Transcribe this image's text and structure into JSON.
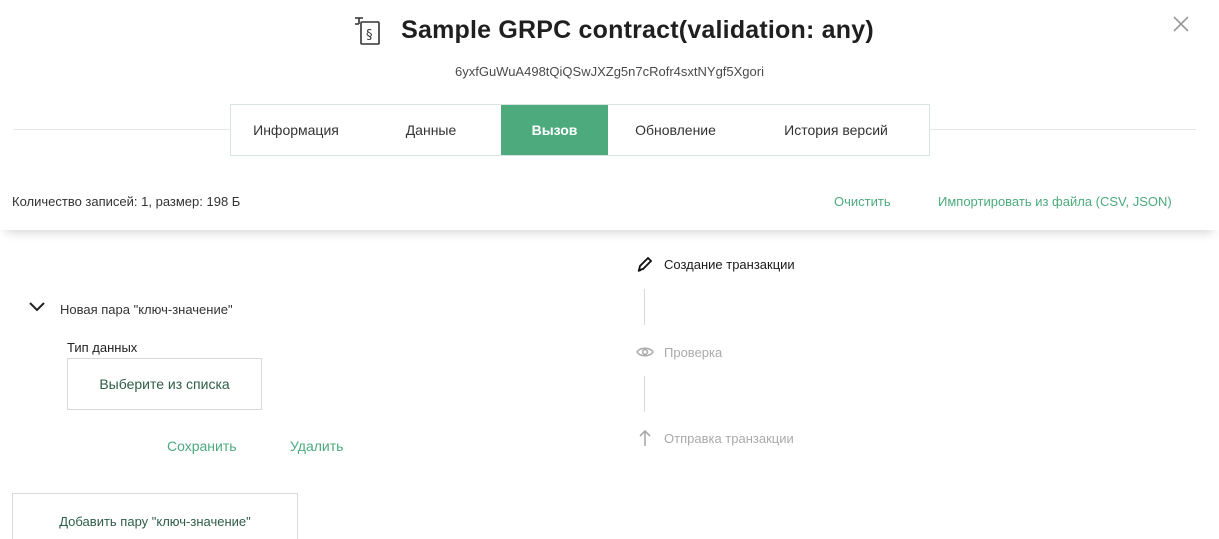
{
  "header": {
    "title": "Sample GRPC contract(validation: any)",
    "contract_id": "6yxfGuWuA498tQiQSwJXZg5n7cRofr4sxtNYgf5Xgori",
    "contract_icon": "contract-document-icon",
    "close_icon": "close-icon"
  },
  "tabs": [
    {
      "label": "Информация",
      "active": false
    },
    {
      "label": "Данные",
      "active": false
    },
    {
      "label": "Вызов",
      "active": true
    },
    {
      "label": "Обновление",
      "active": false
    },
    {
      "label": "История версий",
      "active": false
    }
  ],
  "info_bar": {
    "records": "Количество записей: 1, размер: 198 Б",
    "clear_label": "Очистить",
    "import_label": "Импортировать из файла (CSV, JSON)"
  },
  "form": {
    "pair_title": "Новая пара \"ключ-значение\"",
    "type_label": "Тип данных",
    "type_select_value": "Выберите из списка",
    "save_label": "Сохранить",
    "delete_label": "Удалить",
    "add_pair_label": "Добавить пару \"ключ-значение\""
  },
  "steps": [
    {
      "label": "Создание транзакции",
      "icon": "pencil-icon",
      "state": "active"
    },
    {
      "label": "Проверка",
      "icon": "eye-icon",
      "state": "inactive"
    },
    {
      "label": "Отправка транзакции",
      "icon": "arrow-up-icon",
      "state": "inactive"
    }
  ],
  "colors": {
    "accent": "#4caa7d",
    "inactive_text": "#aaaaaa"
  }
}
